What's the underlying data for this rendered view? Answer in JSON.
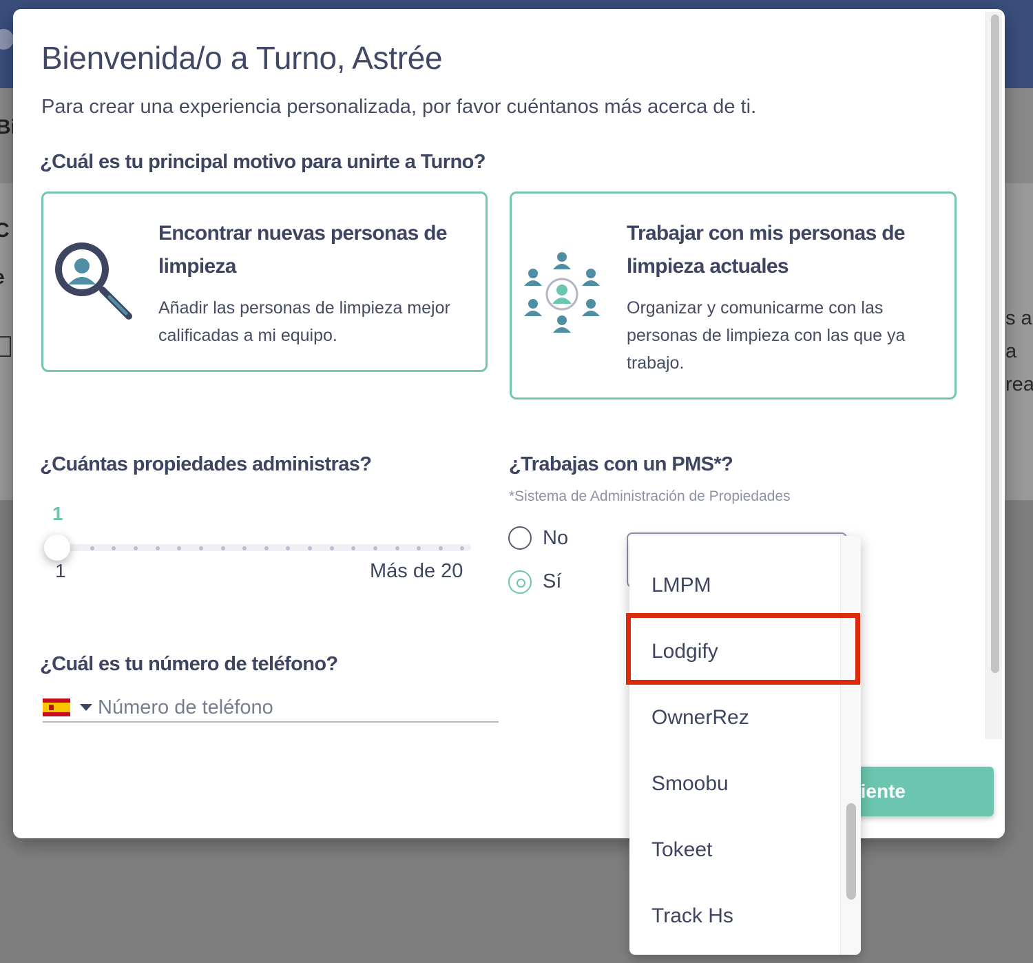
{
  "modal": {
    "title": "Bienvenida/o a Turno, Astrée",
    "subtitle": "Para crear una experiencia personalizada, por favor cuéntanos más acerca de ti."
  },
  "motive": {
    "question": "¿Cuál es tu principal motivo para unirte a Turno?",
    "options": [
      {
        "title": "Encontrar nuevas personas de limpieza",
        "description": "Añadir las personas de limpieza mejor calificadas a mi equipo.",
        "icon": "magnifier-person-icon"
      },
      {
        "title": "Trabajar con mis personas de limpieza actuales",
        "description": "Organizar y comunicarme con las personas de limpieza con las que ya trabajo.",
        "icon": "team-network-icon"
      }
    ]
  },
  "properties": {
    "question": "¿Cuántas propiedades administras?",
    "value": "1",
    "min_label": "1",
    "max_label": "Más de 20"
  },
  "pms": {
    "question": "¿Trabajas con un PMS*?",
    "note": "*Sistema de Administración de Propiedades",
    "radio_no": "No",
    "radio_si": "Sí",
    "selected": "Sí",
    "dropdown_items": [
      "LMPM",
      "Lodgify",
      "OwnerRez",
      "Smoobu",
      "Tokeet",
      "Track Hs"
    ],
    "highlighted_item": "Lodgify"
  },
  "phone": {
    "question": "¿Cuál es tu número de teléfono?",
    "placeholder": "Número de teléfono",
    "country_flag": "spain-flag-icon"
  },
  "next_button": {
    "label_visible": "iente"
  },
  "colors": {
    "accent": "#6cc5ae",
    "card_border": "#74c6b2",
    "text": "#3d4560",
    "highlight": "#dc2a0a",
    "topbar": "#3a4f7e"
  },
  "background_fragments": {
    "left": [
      "Bi",
      "C",
      "e"
    ],
    "right": [
      "s a",
      "a",
      "rea"
    ]
  }
}
